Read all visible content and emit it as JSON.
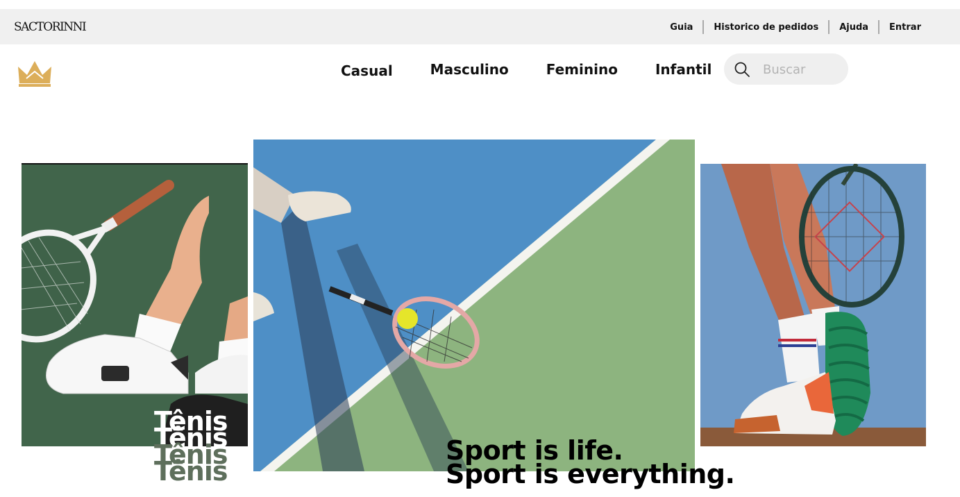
{
  "brand": {
    "logo_text": "SACTORINNI"
  },
  "utility_nav": {
    "guide": "Guia",
    "orders": "Historico de pedidos",
    "help": "Ajuda",
    "login": "Entrar"
  },
  "main_nav": {
    "items": [
      "Casual",
      "Masculino",
      "Feminino",
      "Infantil"
    ]
  },
  "search": {
    "placeholder": "Buscar",
    "value": ""
  },
  "hero": {
    "stacked_word": "Tênis",
    "slogan_line1": "Sport is life.",
    "slogan_line2": "Sport is everything."
  },
  "colors": {
    "topbar_bg": "#f0f0f0",
    "crown_gold": "#dcae5a",
    "court_green": "#8fb37f",
    "court_blue": "#4d8fc4",
    "tenis_green": "#5e6f5c"
  },
  "icons": {
    "logo": "crown-icon",
    "search": "search-icon"
  }
}
